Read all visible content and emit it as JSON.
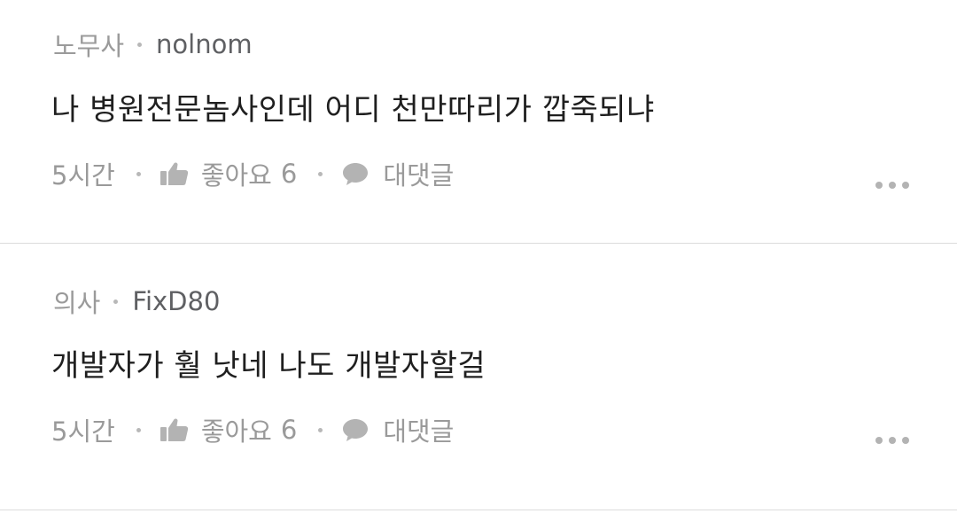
{
  "comments": [
    {
      "job": "노무사",
      "nickname": "nolnom",
      "text": "나 병원전문놈사인데 어디 천만따리가 깝죽되냐",
      "time": "5시간",
      "like_label": "좋아요",
      "like_count": "6",
      "reply_label": "대댓글"
    },
    {
      "job": "의사",
      "nickname": "FixD80",
      "text": "개발자가 훨 낫네 나도 개발자할걸",
      "time": "5시간",
      "like_label": "좋아요",
      "like_count": "6",
      "reply_label": "대댓글"
    }
  ],
  "icons": {
    "like": "thumbs-up-icon",
    "reply": "speech-bubble-icon",
    "more": "more-horizontal-icon"
  },
  "colors": {
    "meta_text": "#9a9a9a",
    "nickname": "#5f6063",
    "body_text": "#1f1f1f",
    "icon": "#b3b3b3",
    "divider": "#dcdcdc"
  }
}
